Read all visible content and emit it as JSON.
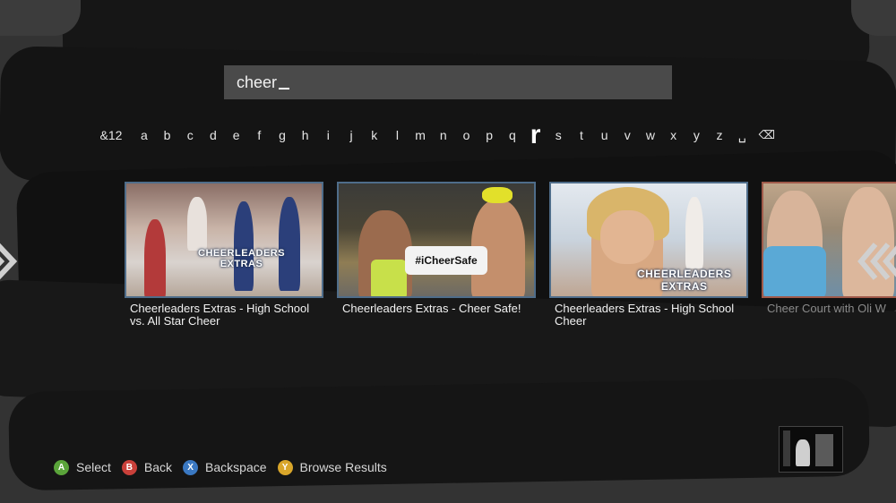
{
  "search": {
    "query": "cheer"
  },
  "keyboard": {
    "symbols_key": "&12",
    "letters": [
      "a",
      "b",
      "c",
      "d",
      "e",
      "f",
      "g",
      "h",
      "i",
      "j",
      "k",
      "l",
      "m",
      "n",
      "o",
      "p",
      "q",
      "r",
      "s",
      "t",
      "u",
      "v",
      "w",
      "x",
      "y",
      "z"
    ],
    "selected_letter": "r",
    "space_key": "␣",
    "backspace_key": "⌫"
  },
  "results": [
    {
      "title": "Cheerleaders Extras - High School vs. All Star Cheer",
      "logo_line1": "CHEERLEADERS",
      "logo_line2": "EXTRAS"
    },
    {
      "title": "Cheerleaders Extras - Cheer Safe!",
      "sign_text": "#iCheerSafe"
    },
    {
      "title": "Cheerleaders Extras - High School Cheer",
      "logo_line1": "CHEERLEADERS",
      "logo_line2": "EXTRAS"
    },
    {
      "title": "Cheer Court with Oli W"
    }
  ],
  "nav": {
    "left_arrow": "❮",
    "right_arrow": "❮"
  },
  "hints": [
    {
      "button": "A",
      "label": "Select",
      "color": "#5aa43a"
    },
    {
      "button": "B",
      "label": "Back",
      "color": "#c9403a"
    },
    {
      "button": "X",
      "label": "Backspace",
      "color": "#3a78c2"
    },
    {
      "button": "Y",
      "label": "Browse Results",
      "color": "#d9a62a"
    }
  ]
}
